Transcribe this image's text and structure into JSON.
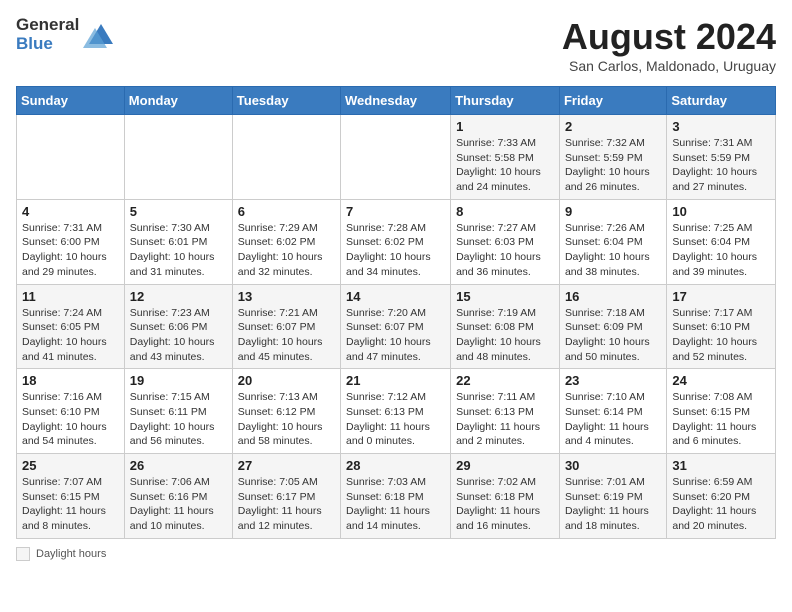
{
  "logo": {
    "general": "General",
    "blue": "Blue"
  },
  "title": "August 2024",
  "subtitle": "San Carlos, Maldonado, Uruguay",
  "days_of_week": [
    "Sunday",
    "Monday",
    "Tuesday",
    "Wednesday",
    "Thursday",
    "Friday",
    "Saturday"
  ],
  "legend_label": "Daylight hours",
  "weeks": [
    [
      {
        "day": "",
        "info": ""
      },
      {
        "day": "",
        "info": ""
      },
      {
        "day": "",
        "info": ""
      },
      {
        "day": "",
        "info": ""
      },
      {
        "day": "1",
        "info": "Sunrise: 7:33 AM\nSunset: 5:58 PM\nDaylight: 10 hours and 24 minutes."
      },
      {
        "day": "2",
        "info": "Sunrise: 7:32 AM\nSunset: 5:59 PM\nDaylight: 10 hours and 26 minutes."
      },
      {
        "day": "3",
        "info": "Sunrise: 7:31 AM\nSunset: 5:59 PM\nDaylight: 10 hours and 27 minutes."
      }
    ],
    [
      {
        "day": "4",
        "info": "Sunrise: 7:31 AM\nSunset: 6:00 PM\nDaylight: 10 hours and 29 minutes."
      },
      {
        "day": "5",
        "info": "Sunrise: 7:30 AM\nSunset: 6:01 PM\nDaylight: 10 hours and 31 minutes."
      },
      {
        "day": "6",
        "info": "Sunrise: 7:29 AM\nSunset: 6:02 PM\nDaylight: 10 hours and 32 minutes."
      },
      {
        "day": "7",
        "info": "Sunrise: 7:28 AM\nSunset: 6:02 PM\nDaylight: 10 hours and 34 minutes."
      },
      {
        "day": "8",
        "info": "Sunrise: 7:27 AM\nSunset: 6:03 PM\nDaylight: 10 hours and 36 minutes."
      },
      {
        "day": "9",
        "info": "Sunrise: 7:26 AM\nSunset: 6:04 PM\nDaylight: 10 hours and 38 minutes."
      },
      {
        "day": "10",
        "info": "Sunrise: 7:25 AM\nSunset: 6:04 PM\nDaylight: 10 hours and 39 minutes."
      }
    ],
    [
      {
        "day": "11",
        "info": "Sunrise: 7:24 AM\nSunset: 6:05 PM\nDaylight: 10 hours and 41 minutes."
      },
      {
        "day": "12",
        "info": "Sunrise: 7:23 AM\nSunset: 6:06 PM\nDaylight: 10 hours and 43 minutes."
      },
      {
        "day": "13",
        "info": "Sunrise: 7:21 AM\nSunset: 6:07 PM\nDaylight: 10 hours and 45 minutes."
      },
      {
        "day": "14",
        "info": "Sunrise: 7:20 AM\nSunset: 6:07 PM\nDaylight: 10 hours and 47 minutes."
      },
      {
        "day": "15",
        "info": "Sunrise: 7:19 AM\nSunset: 6:08 PM\nDaylight: 10 hours and 48 minutes."
      },
      {
        "day": "16",
        "info": "Sunrise: 7:18 AM\nSunset: 6:09 PM\nDaylight: 10 hours and 50 minutes."
      },
      {
        "day": "17",
        "info": "Sunrise: 7:17 AM\nSunset: 6:10 PM\nDaylight: 10 hours and 52 minutes."
      }
    ],
    [
      {
        "day": "18",
        "info": "Sunrise: 7:16 AM\nSunset: 6:10 PM\nDaylight: 10 hours and 54 minutes."
      },
      {
        "day": "19",
        "info": "Sunrise: 7:15 AM\nSunset: 6:11 PM\nDaylight: 10 hours and 56 minutes."
      },
      {
        "day": "20",
        "info": "Sunrise: 7:13 AM\nSunset: 6:12 PM\nDaylight: 10 hours and 58 minutes."
      },
      {
        "day": "21",
        "info": "Sunrise: 7:12 AM\nSunset: 6:13 PM\nDaylight: 11 hours and 0 minutes."
      },
      {
        "day": "22",
        "info": "Sunrise: 7:11 AM\nSunset: 6:13 PM\nDaylight: 11 hours and 2 minutes."
      },
      {
        "day": "23",
        "info": "Sunrise: 7:10 AM\nSunset: 6:14 PM\nDaylight: 11 hours and 4 minutes."
      },
      {
        "day": "24",
        "info": "Sunrise: 7:08 AM\nSunset: 6:15 PM\nDaylight: 11 hours and 6 minutes."
      }
    ],
    [
      {
        "day": "25",
        "info": "Sunrise: 7:07 AM\nSunset: 6:15 PM\nDaylight: 11 hours and 8 minutes."
      },
      {
        "day": "26",
        "info": "Sunrise: 7:06 AM\nSunset: 6:16 PM\nDaylight: 11 hours and 10 minutes."
      },
      {
        "day": "27",
        "info": "Sunrise: 7:05 AM\nSunset: 6:17 PM\nDaylight: 11 hours and 12 minutes."
      },
      {
        "day": "28",
        "info": "Sunrise: 7:03 AM\nSunset: 6:18 PM\nDaylight: 11 hours and 14 minutes."
      },
      {
        "day": "29",
        "info": "Sunrise: 7:02 AM\nSunset: 6:18 PM\nDaylight: 11 hours and 16 minutes."
      },
      {
        "day": "30",
        "info": "Sunrise: 7:01 AM\nSunset: 6:19 PM\nDaylight: 11 hours and 18 minutes."
      },
      {
        "day": "31",
        "info": "Sunrise: 6:59 AM\nSunset: 6:20 PM\nDaylight: 11 hours and 20 minutes."
      }
    ]
  ]
}
